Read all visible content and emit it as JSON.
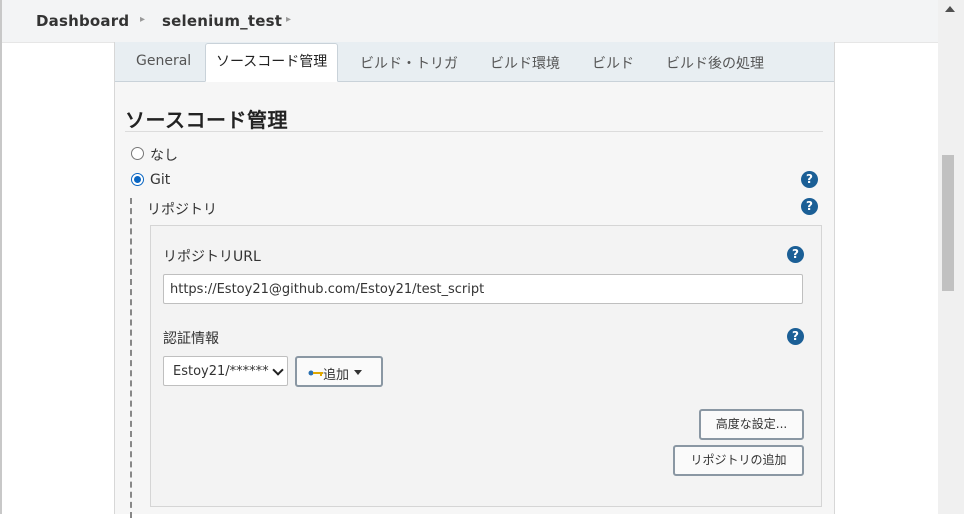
{
  "breadcrumb": {
    "items": [
      {
        "label": "Dashboard"
      },
      {
        "label": "selenium_test"
      }
    ]
  },
  "tabs": [
    {
      "label": "General",
      "active": false
    },
    {
      "label": "ソースコード管理",
      "active": true
    },
    {
      "label": "ビルド・トリガ",
      "active": false
    },
    {
      "label": "ビルド環境",
      "active": false
    },
    {
      "label": "ビルド",
      "active": false
    },
    {
      "label": "ビルド後の処理",
      "active": false
    }
  ],
  "section": {
    "title": "ソースコード管理",
    "options": [
      {
        "label": "なし",
        "checked": false
      },
      {
        "label": "Git",
        "checked": true
      }
    ]
  },
  "repository": {
    "group_label": "リポジトリ",
    "url_label": "リポジトリURL",
    "url_value": "https://Estoy21@github.com/Estoy21/test_script",
    "credentials_label": "認証情報",
    "credentials_selected": "Estoy21/******",
    "add_button_label": "追加",
    "advanced_button_label": "高度な設定...",
    "add_repository_button_label": "リポジトリの追加"
  },
  "help_icon_text": "?",
  "colors": {
    "accent": "#0a66c2",
    "help_icon": "#1b5f96",
    "tab_bar": "#e8eef2"
  },
  "icons": {
    "breadcrumb_separator": "chevron-right-icon",
    "help": "question-circle-icon",
    "credential_key": "key-icon",
    "dropdown": "caret-down-icon",
    "scroll_up": "scroll-up-arrow-icon"
  }
}
